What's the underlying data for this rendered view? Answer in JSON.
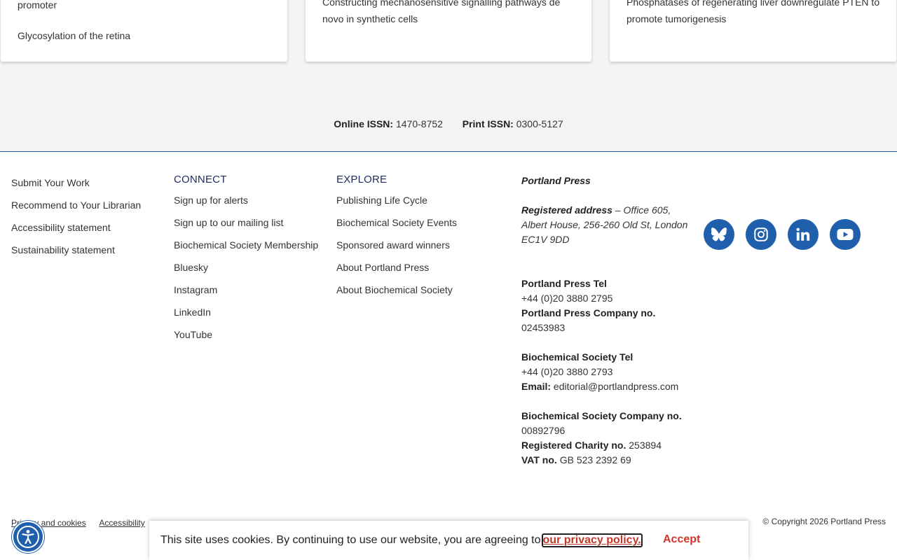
{
  "cards": [
    {
      "lines": [
        "promoter",
        "Glycosylation of the retina"
      ]
    },
    {
      "lines": [
        "Constructing mechanosensitive signalling pathways de",
        "novo in synthetic cells"
      ]
    },
    {
      "lines": [
        "Phosphatases of regenerating liver downregulate PTEN to",
        "promote tumorigenesis"
      ]
    }
  ],
  "issn": {
    "online_label": "Online ISSN:",
    "online_value": "1470-8752",
    "print_label": "Print ISSN:",
    "print_value": "0300-5127"
  },
  "footer": {
    "col1": [
      "Submit Your Work",
      "Recommend to Your Librarian",
      "Accessibility statement",
      "Sustainability statement"
    ],
    "connect": {
      "heading": "CONNECT",
      "links": [
        "Sign up for alerts",
        "Sign up to our mailing list",
        "Biochemical Society Membership",
        "Bluesky",
        "Instagram",
        "LinkedIn",
        "YouTube"
      ]
    },
    "explore": {
      "heading": "EXPLORE",
      "links": [
        "Publishing Life Cycle",
        "Biochemical Society Events",
        "Sponsored award winners",
        "About Portland Press",
        "About Biochemical Society"
      ]
    },
    "address": {
      "org": "Portland Press",
      "registered_label": "Registered address",
      "registered_value": " – Office 605, Albert House, 256-260 Old St, London EC1V 9DD",
      "pp_tel_label": "Portland Press Tel",
      "pp_tel": "+44 (0)20 3880 2795",
      "pp_company_label": "Portland Press Company no.",
      "pp_company": "02453983",
      "bs_tel_label": "Biochemical Society Tel",
      "bs_tel": "+44 (0)20 3880 2793",
      "email_label": "Email:",
      "email": "editorial@portlandpress.com",
      "bs_company_label": "Biochemical Society Company no.",
      "bs_company": "00892796",
      "charity_label": "Registered Charity no.",
      "charity": "253894",
      "vat_label": "VAT no.",
      "vat": "GB 523 2392 69"
    },
    "socials": [
      "bluesky-icon",
      "instagram-icon",
      "linkedin-icon",
      "youtube-icon"
    ],
    "bottom_links": [
      "Privacy and cookies",
      "Accessibility"
    ],
    "copyright": "© Copyright 2026 Portland Press"
  },
  "cookie": {
    "text": "This site uses cookies. By continuing to use our website, you are agreeing to",
    "link": "our privacy policy.",
    "accept": "Accept"
  },
  "colors": {
    "brand_blue": "#1f5fab",
    "accept_red": "#d0352a",
    "heading_navy": "#1f2a5c"
  }
}
